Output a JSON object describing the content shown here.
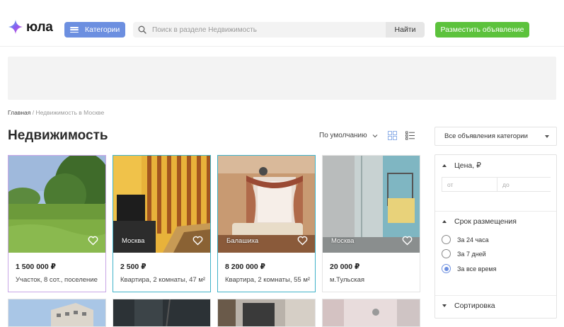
{
  "header": {
    "logo_text": "юла",
    "categories_label": "Категории",
    "search_placeholder": "Поиск в разделе Недвижимость",
    "find_label": "Найти",
    "post_ad_label": "Разместить объявление"
  },
  "breadcrumb": {
    "home": "Главная",
    "separator": " / ",
    "current": "Недвижимость в Москве"
  },
  "page": {
    "title": "Недвижимость",
    "sort_label": "По умолчанию"
  },
  "listings": [
    {
      "price": "1 500 000 ₽",
      "title": "Участок, 8 сот., поселение",
      "location": ""
    },
    {
      "price": "2 500 ₽",
      "title": "Квартира, 2 комнаты, 47 м²",
      "location": "Москва"
    },
    {
      "price": "8 200 000 ₽",
      "title": "Квартира, 2 комнаты, 55 м²",
      "location": "Балашиха"
    },
    {
      "price": "20 000 ₽",
      "title": "м.Тульская",
      "location": "Москва"
    }
  ],
  "sidebar": {
    "category_select": "Все объявления категории",
    "price": {
      "title": "Цена, ₽",
      "from_placeholder": "от",
      "to_placeholder": "до"
    },
    "period": {
      "title": "Срок размещения",
      "options": [
        "За 24 часа",
        "За 7 дней",
        "За все время"
      ],
      "selected_index": 2
    },
    "sorting_title": "Сортировка"
  },
  "colors": {
    "accent_blue": "#6c8fe0",
    "accent_green": "#5cc23c"
  }
}
